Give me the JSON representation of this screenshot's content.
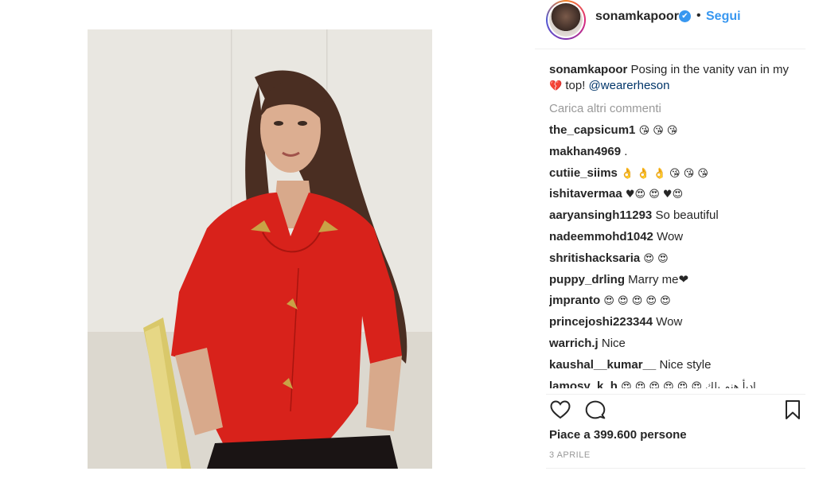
{
  "header": {
    "username": "sonamkapoor",
    "verified_glyph": "✔",
    "separator": "•",
    "follow_label": "Segui"
  },
  "caption": {
    "username": "sonamkapoor",
    "text_before": "Posing in the vanity van in my",
    "emoji": "💔",
    "text_after": " top!",
    "mention": "@wearerheson"
  },
  "load_more_label": "Carica altri commenti",
  "comments": [
    {
      "user": "the_capsicum1",
      "text": "😘 😘 😘"
    },
    {
      "user": "makhan4969",
      "text": "."
    },
    {
      "user": "cutiie_siims",
      "text": "👌 👌 👌 😘 😘 😘"
    },
    {
      "user": "ishitavermaa",
      "text": "♥😍 😍 ♥😍"
    },
    {
      "user": "aaryansingh11293",
      "text": "So beautiful"
    },
    {
      "user": "nadeemmohd1042",
      "text": "Wow"
    },
    {
      "user": "shritishacksaria",
      "text": "😍 😍"
    },
    {
      "user": "puppy_drling",
      "text": "Marry me❤"
    },
    {
      "user": "jmpranto",
      "text": "😍 😍 😍 😍 😍"
    },
    {
      "user": "princejoshi223344",
      "text": "Wow"
    },
    {
      "user": "warrich.j",
      "text": "Nice"
    },
    {
      "user": "kaushal__kumar__",
      "text": "Nice style"
    },
    {
      "user": "lamosy_k_h",
      "text": "😍 😍 😍 😍 😍 😍 ادبأ هنم ىلك"
    }
  ],
  "actions": {
    "like_icon": "heart-icon",
    "comment_icon": "comment-icon",
    "save_icon": "bookmark-icon"
  },
  "likes_text": "Piace a 399.600 persone",
  "date_text": "3 APRILE",
  "colors": {
    "accent": "#3897f0",
    "mention": "#003569",
    "muted": "#999999",
    "shirt": "#d8221b"
  }
}
